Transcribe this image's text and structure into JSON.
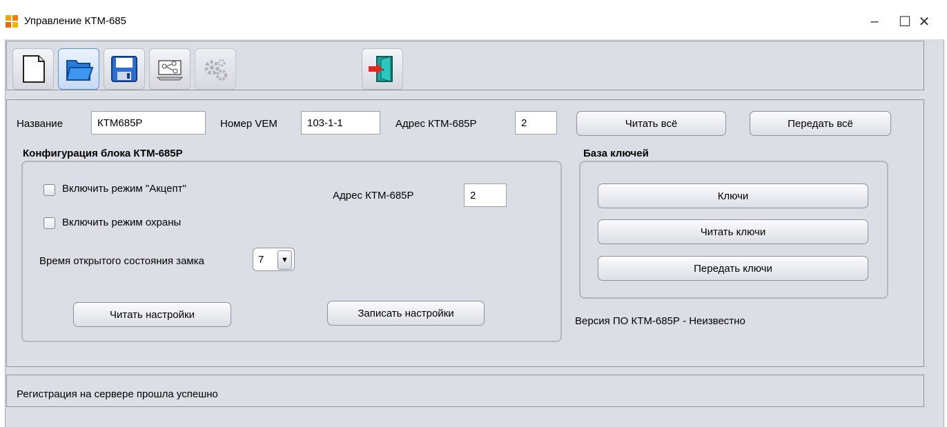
{
  "window": {
    "title": "Управление КТМ-685",
    "minimize": "–",
    "maximize": "☐",
    "close": "✕"
  },
  "toolbar": {
    "icons": [
      "new-document-icon",
      "open-folder-icon",
      "save-disk-icon",
      "network-icon",
      "settings-gears-icon",
      "exit-door-icon"
    ]
  },
  "header": {
    "name_label": "Название",
    "name_value": "КТМ685Р",
    "vem_label": "Номер VEM",
    "vem_value": "103-1-1",
    "addr_label": "Адрес КТМ-685Р",
    "addr_value": "2",
    "read_all": "Читать всё",
    "send_all": "Передать всё"
  },
  "config": {
    "title": "Конфигурация блока КТМ-685Р",
    "accept_label": "Включить режим \"Акцепт\"",
    "accept_checked": false,
    "guard_label": "Включить режим охраны",
    "guard_checked": false,
    "addr_label": "Адрес КТМ-685Р",
    "addr_value": "2",
    "lock_time_label": "Время открытого состояния замка",
    "lock_time_value": "7",
    "read_settings": "Читать настройки",
    "write_settings": "Записать настройки"
  },
  "keys": {
    "title": "База ключей",
    "keys_button": "Ключи",
    "read_keys": "Читать ключи",
    "send_keys": "Передать ключи",
    "version": "Версия ПО КТМ-685Р - Неизвестно"
  },
  "status": {
    "text": "Регистрация на сервере прошла успешно"
  }
}
